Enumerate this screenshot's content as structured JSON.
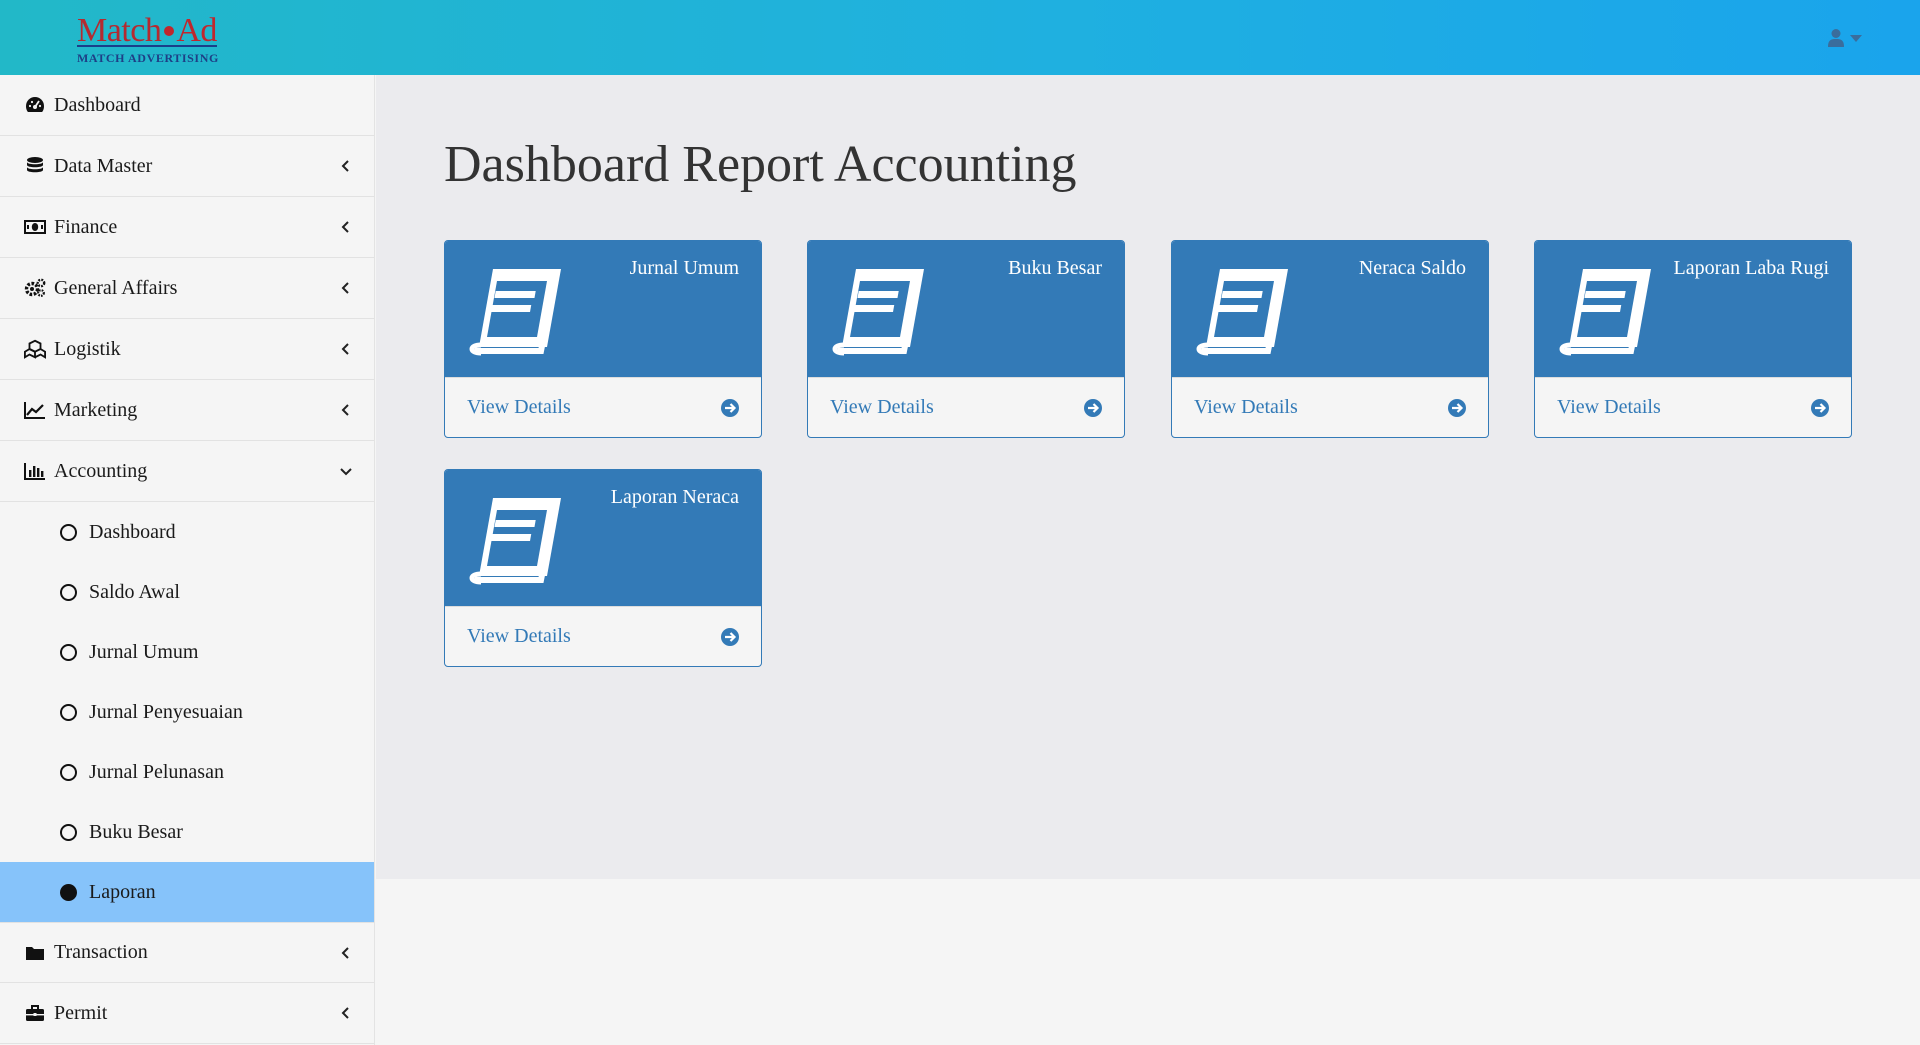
{
  "brand": {
    "name_left": "Match",
    "name_right": "Ad",
    "tagline": "MATCH ADVERTISING"
  },
  "colors": {
    "topbar_from": "#22b8c8",
    "topbar_to": "#1aa4ec",
    "card_blue": "#337ab7",
    "active_item": "#86c3fa"
  },
  "header": {
    "user_icon": "user-icon"
  },
  "sidebar": {
    "items": [
      {
        "label": "Dashboard",
        "icon": "tachometer-icon"
      },
      {
        "label": "Data Master",
        "icon": "database-icon"
      },
      {
        "label": "Finance",
        "icon": "money-icon"
      },
      {
        "label": "General Affairs",
        "icon": "gears-icon"
      },
      {
        "label": "Logistik",
        "icon": "cubes-icon"
      },
      {
        "label": "Marketing",
        "icon": "line-chart-icon"
      },
      {
        "label": "Accounting",
        "icon": "bar-chart-icon"
      }
    ],
    "accounting_sub": [
      {
        "label": "Dashboard"
      },
      {
        "label": "Saldo Awal"
      },
      {
        "label": "Jurnal Umum"
      },
      {
        "label": "Jurnal Penyesuaian"
      },
      {
        "label": "Jurnal Pelunasan"
      },
      {
        "label": "Buku Besar"
      },
      {
        "label": "Laporan",
        "active": true
      }
    ],
    "items_after": [
      {
        "label": "Transaction",
        "icon": "folder-icon"
      },
      {
        "label": "Permit",
        "icon": "briefcase-icon"
      }
    ]
  },
  "main": {
    "title": "Dashboard Report Accounting",
    "cards": [
      {
        "title": "Jurnal Umum",
        "link": "View Details"
      },
      {
        "title": "Buku Besar",
        "link": "View Details"
      },
      {
        "title": "Neraca Saldo",
        "link": "View Details"
      },
      {
        "title": "Laporan Laba Rugi",
        "link": "View Details"
      },
      {
        "title": "Laporan Neraca",
        "link": "View Details"
      }
    ]
  }
}
